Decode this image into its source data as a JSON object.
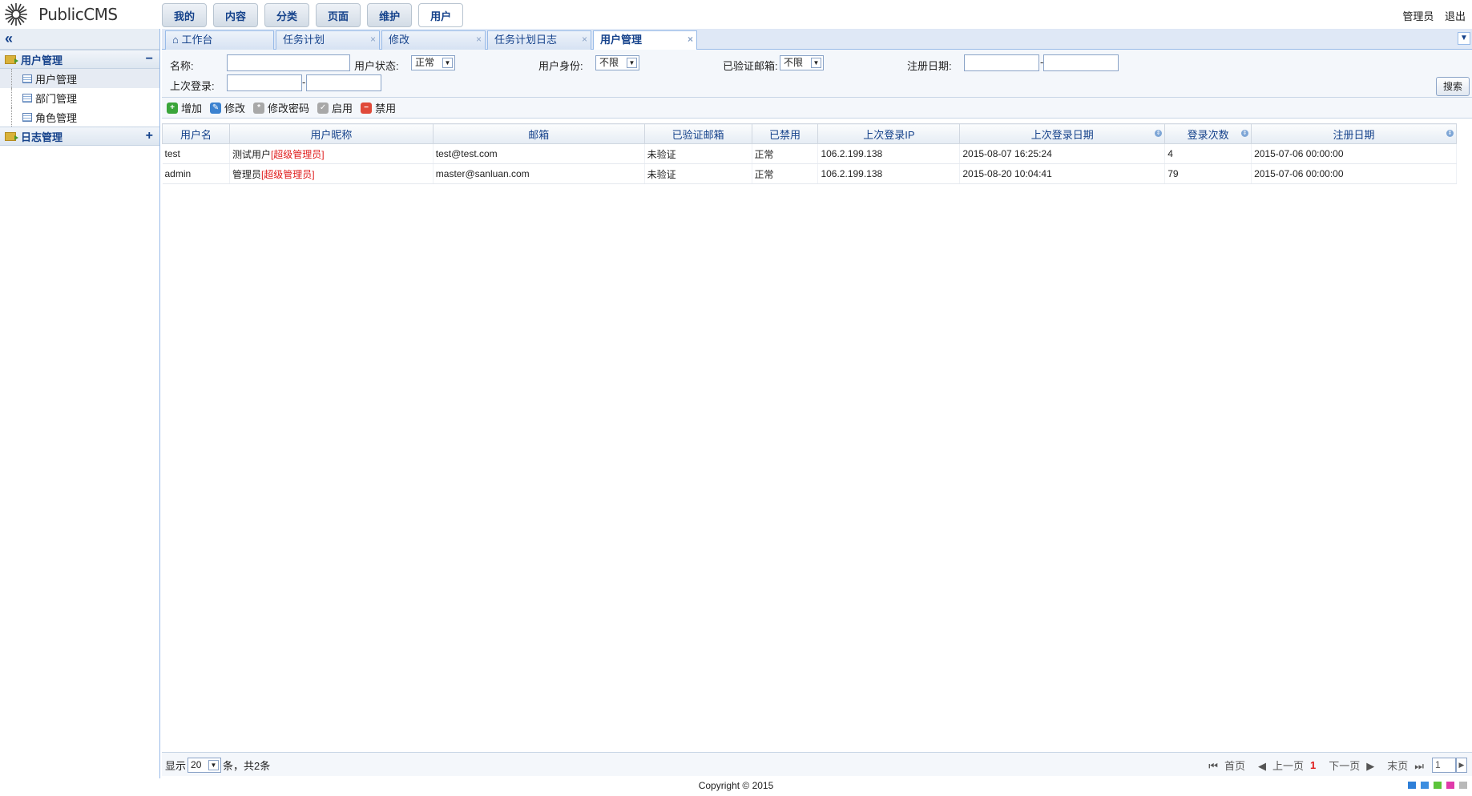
{
  "app": {
    "name": "PublicCMS"
  },
  "nav": [
    "我的",
    "内容",
    "分类",
    "页面",
    "维护",
    "用户"
  ],
  "user_links": {
    "user": "管理员",
    "logout": "退出"
  },
  "sidebar": {
    "collapse": "«",
    "groups": [
      {
        "label": "用户管理",
        "toggle": "−",
        "items": [
          "用户管理",
          "部门管理",
          "角色管理"
        ]
      },
      {
        "label": "日志管理",
        "toggle": "+"
      }
    ]
  },
  "tabs": [
    "工作台",
    "任务计划",
    "修改",
    "任务计划日志",
    "用户管理"
  ],
  "search": {
    "name_label": "名称:",
    "status_label": "用户状态:",
    "status_value": "正常",
    "identity_label": "用户身份:",
    "identity_value": "不限",
    "email_label": "已验证邮箱:",
    "email_value": "不限",
    "regdate_label": "注册日期:",
    "dash": "-",
    "lastlogin_label": "上次登录:",
    "button": "搜索"
  },
  "toolbar": {
    "add": "增加",
    "edit": "修改",
    "password": "修改密码",
    "enable": "启用",
    "disable": "禁用"
  },
  "table": {
    "columns": [
      "用户名",
      "用户昵称",
      "邮箱",
      "已验证邮箱",
      "已禁用",
      "上次登录IP",
      "上次登录日期",
      "登录次数",
      "注册日期"
    ],
    "rows": [
      {
        "username": "test",
        "nick": "测试用户",
        "role": "[超级管理员]",
        "email": "test@test.com",
        "verified": "未验证",
        "disabled": "正常",
        "ip": "106.2.199.138",
        "last_login": "2015-08-07 16:25:24",
        "count": "4",
        "reg_date": "2015-07-06 00:00:00"
      },
      {
        "username": "admin",
        "nick": "管理员",
        "role": "[超级管理员]",
        "email": "master@sanluan.com",
        "verified": "未验证",
        "disabled": "正常",
        "ip": "106.2.199.138",
        "last_login": "2015-08-20 10:04:41",
        "count": "79",
        "reg_date": "2015-07-06 00:00:00"
      }
    ]
  },
  "pager": {
    "show": "显示",
    "pagesize": "20",
    "total": "条，共2条",
    "first": "首页",
    "prev": "上一页",
    "current": "1",
    "next": "下一页",
    "last": "末页",
    "page_input": "1"
  },
  "footer": {
    "copyright": "Copyright © 2015"
  },
  "colors": {
    "accent": "#15428b",
    "border": "#99bbe8",
    "red": "#e01c1c"
  },
  "themes": [
    "#2e7fd8",
    "#3c8ee0",
    "#5cc43a",
    "#e03aaa",
    "#b9b9b9"
  ]
}
